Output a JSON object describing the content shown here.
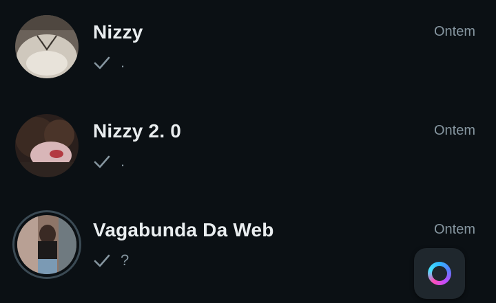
{
  "chats": [
    {
      "name": "Nizzy",
      "time": "Ontem",
      "preview": ".",
      "status_icon": "single-check-icon"
    },
    {
      "name": "Nizzy 2. 0",
      "time": "Ontem",
      "preview": ".",
      "status_icon": "single-check-icon"
    },
    {
      "name": "Vagabunda Da Web",
      "time": "Ontem",
      "preview": "?",
      "status_icon": "single-check-icon",
      "has_status_ring": true
    }
  ],
  "fab": {
    "icon": "meta-ai-ring-icon"
  },
  "colors": {
    "background": "#0b1014",
    "name_text": "#e9edef",
    "secondary_text": "#8696a0",
    "fab_background": "#1f272d"
  }
}
